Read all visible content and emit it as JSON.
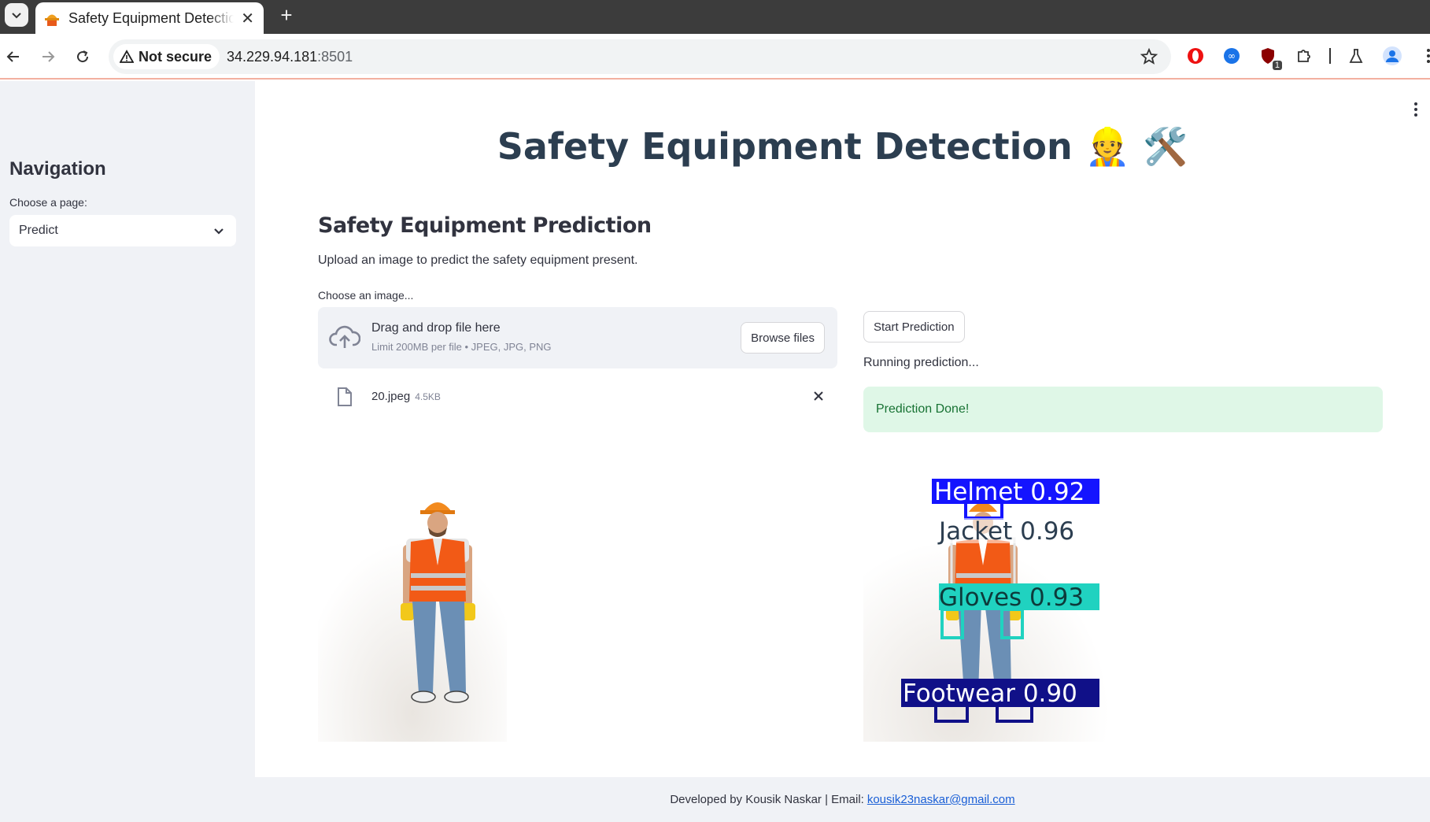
{
  "browser": {
    "tab_title": "Safety Equipment Detection",
    "security_label": "Not secure",
    "url_host": "34.229.94.181",
    "url_port": ":8501",
    "extension_badge": "1"
  },
  "sidebar": {
    "title": "Navigation",
    "select_label": "Choose a page:",
    "select_value": "Predict"
  },
  "main": {
    "page_title": "Safety Equipment Detection 👷 🛠️",
    "subtitle": "Safety Equipment Prediction",
    "description": "Upload an image to predict the safety equipment present.",
    "uploader_label": "Choose an image...",
    "drop_title": "Drag and drop file here",
    "drop_limit": "Limit 200MB per file • JPEG, JPG, PNG",
    "browse_label": "Browse files",
    "file_name": "20.jpeg",
    "file_size": "4.5KB",
    "start_label": "Start Prediction",
    "running_text": "Running prediction...",
    "success_text": "Prediction Done!"
  },
  "detections": [
    {
      "label": "Helmet 0.92",
      "color": "#1414ff"
    },
    {
      "label": "Jacket 0.96",
      "color": "#e6e6e6"
    },
    {
      "label": "Gloves 0.93",
      "color": "#20d2c0"
    },
    {
      "label": "Footwear 0.90",
      "color": "#101088"
    }
  ],
  "footer": {
    "text": "Developed by Kousik Naskar | Email:",
    "email": "kousik23naskar@gmail.com"
  }
}
